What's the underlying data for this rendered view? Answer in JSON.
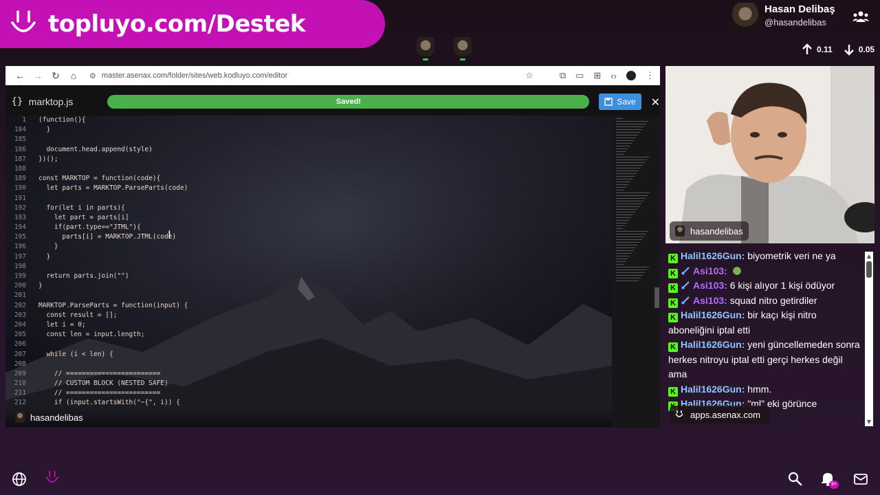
{
  "banner": {
    "text": "topluyo.com/Destek"
  },
  "profile": {
    "name": "Hasan Delibaş",
    "handle": "@hasandelibas"
  },
  "stats": {
    "up": "0.11",
    "down": "0.05"
  },
  "browser": {
    "url": "master.asenax.com/folder/sites/web.kodluyo.com/editor"
  },
  "editor": {
    "file_name": "marktop.js",
    "status": "Saved!",
    "save_label": "Save",
    "lines": [
      {
        "n": "1",
        "t": "(function(){"
      },
      {
        "n": "184",
        "t": "  }"
      },
      {
        "n": "185",
        "t": ""
      },
      {
        "n": "186",
        "t": "  document.head.append(style)"
      },
      {
        "n": "187",
        "t": "})();"
      },
      {
        "n": "188",
        "t": ""
      },
      {
        "n": "189",
        "t": "const MARKTOP = function(code){"
      },
      {
        "n": "190",
        "t": "  let parts = MARKTOP.ParseParts(code)"
      },
      {
        "n": "191",
        "t": ""
      },
      {
        "n": "192",
        "t": "  for(let i in parts){"
      },
      {
        "n": "193",
        "t": "    let part = parts[i]"
      },
      {
        "n": "194",
        "t": "    if(part.type==\"JTML\"){"
      },
      {
        "n": "195",
        "t": "      parts[i] = MARKTOP.JTML(code)"
      },
      {
        "n": "196",
        "t": "    }"
      },
      {
        "n": "197",
        "t": "  }"
      },
      {
        "n": "198",
        "t": ""
      },
      {
        "n": "199",
        "t": "  return parts.join(\"\")"
      },
      {
        "n": "200",
        "t": "}"
      },
      {
        "n": "201",
        "t": ""
      },
      {
        "n": "202",
        "t": "MARKTOP.ParseParts = function(input) {"
      },
      {
        "n": "203",
        "t": "  const result = [];"
      },
      {
        "n": "204",
        "t": "  let i = 0;"
      },
      {
        "n": "205",
        "t": "  const len = input.length;"
      },
      {
        "n": "206",
        "t": ""
      },
      {
        "n": "207",
        "t": "  while (i < len) {"
      },
      {
        "n": "208",
        "t": ""
      },
      {
        "n": "209",
        "t": "    // ========================"
      },
      {
        "n": "210",
        "t": "    // CUSTOM BLOCK (NESTED SAFE)"
      },
      {
        "n": "211",
        "t": "    // ========================"
      },
      {
        "n": "212",
        "t": "    if (input.startsWith(\"~{\", i)) {"
      }
    ],
    "footer_user": "hasandelibas"
  },
  "webcam": {
    "label": "hasandelibas"
  },
  "chat": {
    "messages": [
      {
        "user": "Halil1626Gun:",
        "text": "biyometrik veri ne ya",
        "style": "u1",
        "sword": false
      },
      {
        "user": "Asi103:",
        "text": "",
        "style": "u2",
        "sword": true,
        "emote": true
      },
      {
        "user": "Asi103:",
        "text": "6 kişi alıyor 1 kişi ödüyor",
        "style": "u2",
        "sword": true
      },
      {
        "user": "Asi103:",
        "text": "squad nitro getirdiler",
        "style": "u2",
        "sword": true
      },
      {
        "user": "Halil1626Gun:",
        "text": "bir kaçı kişi nitro aboneliğini iptal etti",
        "style": "u1",
        "sword": false
      },
      {
        "user": "Halil1626Gun:",
        "text": "yeni güncellemeden sonra herkes nitroyu iptal etti gerçi herkes değil ama",
        "style": "u1",
        "sword": false
      },
      {
        "user": "Halil1626Gun:",
        "text": "hmm.",
        "style": "u1",
        "sword": false
      },
      {
        "user": "Halil1626Gun:",
        "text": "\"ml\" eki görünce",
        "style": "u1",
        "sword": false
      }
    ],
    "apps_label": "apps.asenax.com"
  },
  "bottom": {
    "notif_count": "9+"
  }
}
